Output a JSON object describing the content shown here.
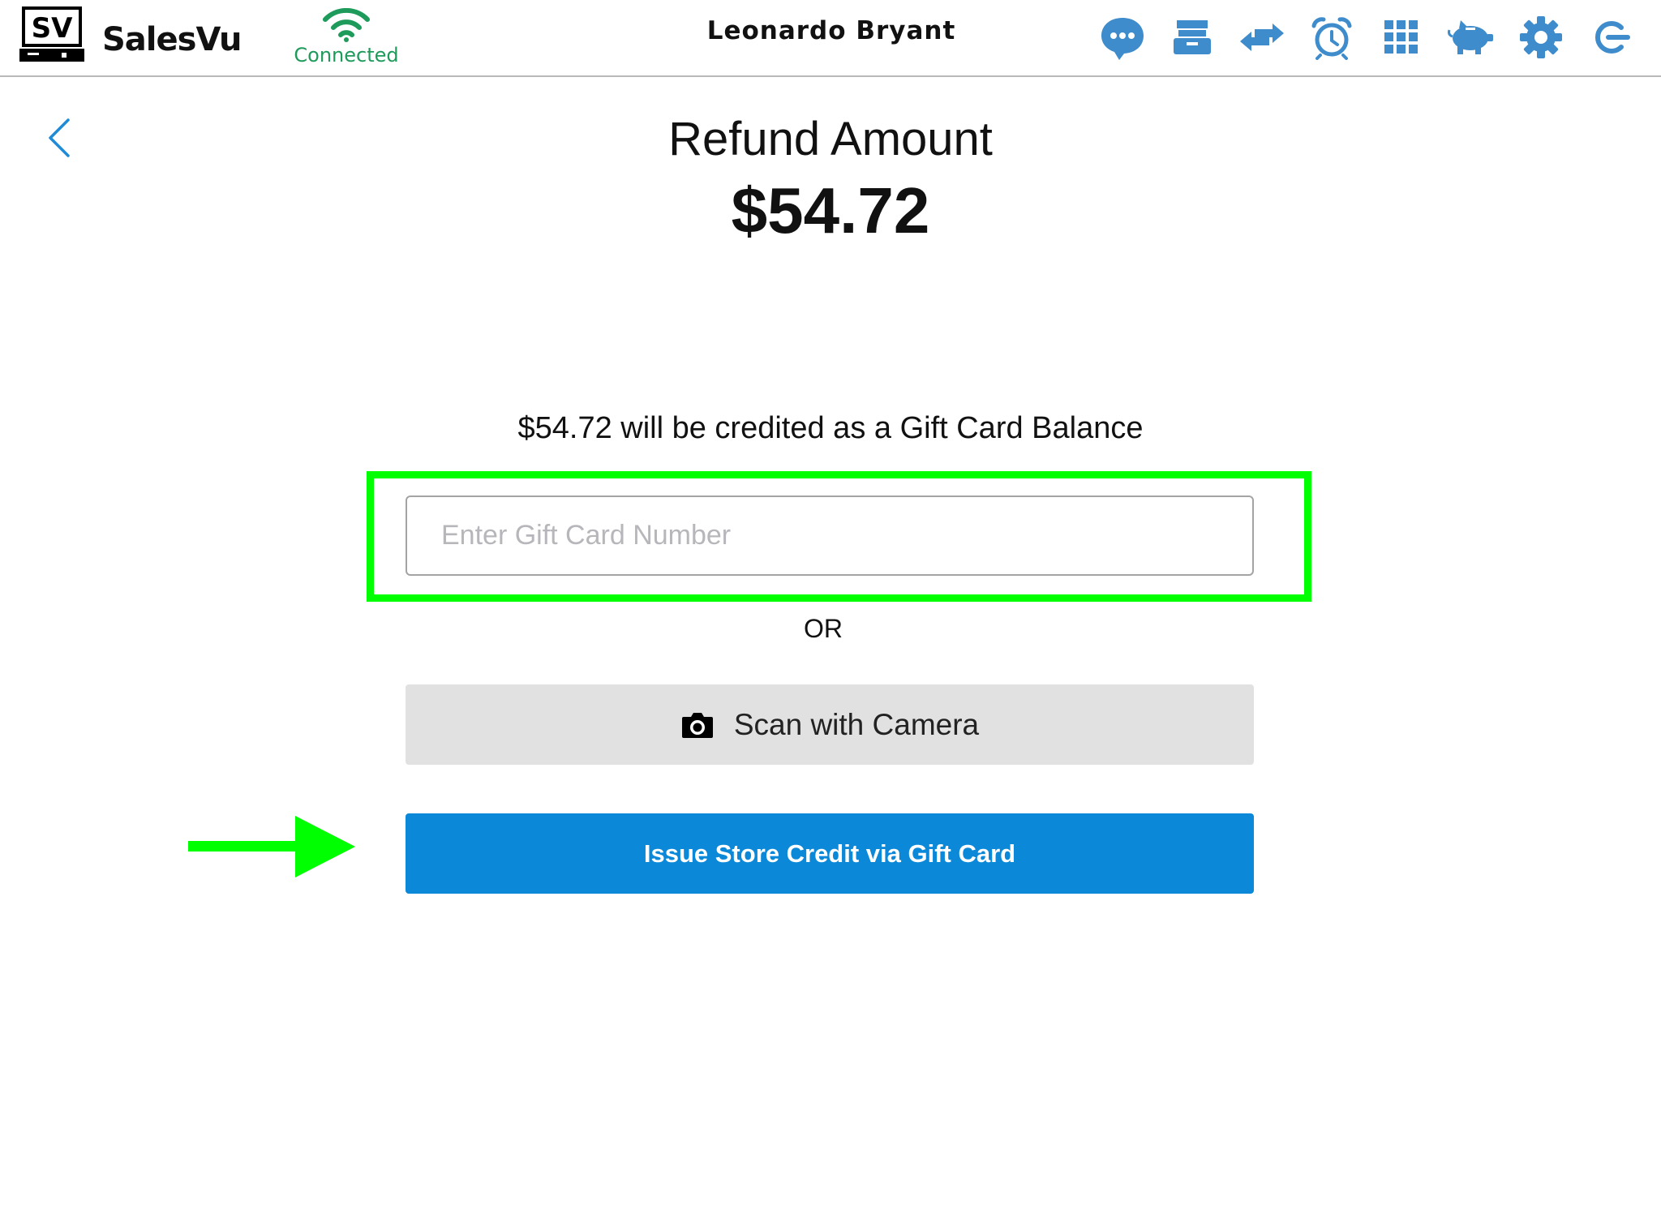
{
  "header": {
    "brand_mark": "SV",
    "brand_name": "SalesVu",
    "connection_status": "Connected",
    "user_name": "Leonardo Bryant",
    "icons": [
      "chat-icon",
      "register-drawer-icon",
      "transfer-icon",
      "alarm-clock-icon",
      "grid-icon",
      "piggy-bank-icon",
      "gear-icon",
      "logout-icon"
    ]
  },
  "main": {
    "back_icon": "chevron-left-icon",
    "title": "Refund Amount",
    "amount": "$54.72",
    "credit_message": "$54.72 will be credited as a Gift Card Balance",
    "gift_card_input": {
      "placeholder": "Enter Gift Card Number",
      "value": ""
    },
    "or_label": "OR",
    "scan_button_label": "Scan with Camera",
    "issue_button_label": "Issue Store Credit via Gift Card"
  },
  "colors": {
    "accent_blue": "#0b88d8",
    "icon_blue": "#3f8ccc",
    "connected_green": "#1e9b5a",
    "annotation_green": "#00ff00",
    "scan_button_bg": "#e1e1e1"
  }
}
